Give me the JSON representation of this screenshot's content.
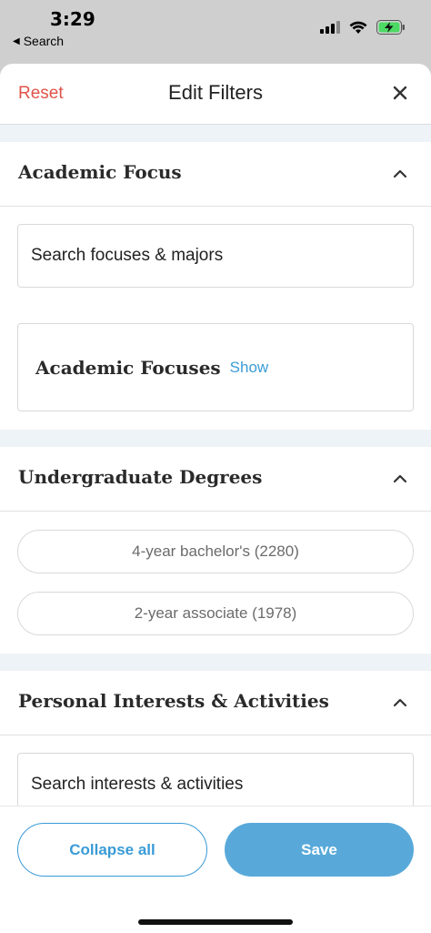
{
  "status_bar": {
    "time": "3:29",
    "back_app": "Search"
  },
  "header": {
    "reset_label": "Reset",
    "title": "Edit Filters"
  },
  "sections": {
    "academic": {
      "title": "Academic Focus",
      "search_placeholder": "Search focuses & majors",
      "focuses_title": "Academic Focuses",
      "show_label": "Show"
    },
    "degrees": {
      "title": "Undergraduate Degrees",
      "options": [
        "4-year bachelor's (2280)",
        "2-year associate (1978)"
      ]
    },
    "interests": {
      "title": "Personal Interests & Activities",
      "search_placeholder": "Search interests & activities"
    }
  },
  "footer": {
    "collapse_label": "Collapse all",
    "save_label": "Save"
  },
  "colors": {
    "accent": "#3a9bd6",
    "reset": "#e0534b",
    "save_bg": "#58a9da",
    "band": "#eef3f7"
  }
}
